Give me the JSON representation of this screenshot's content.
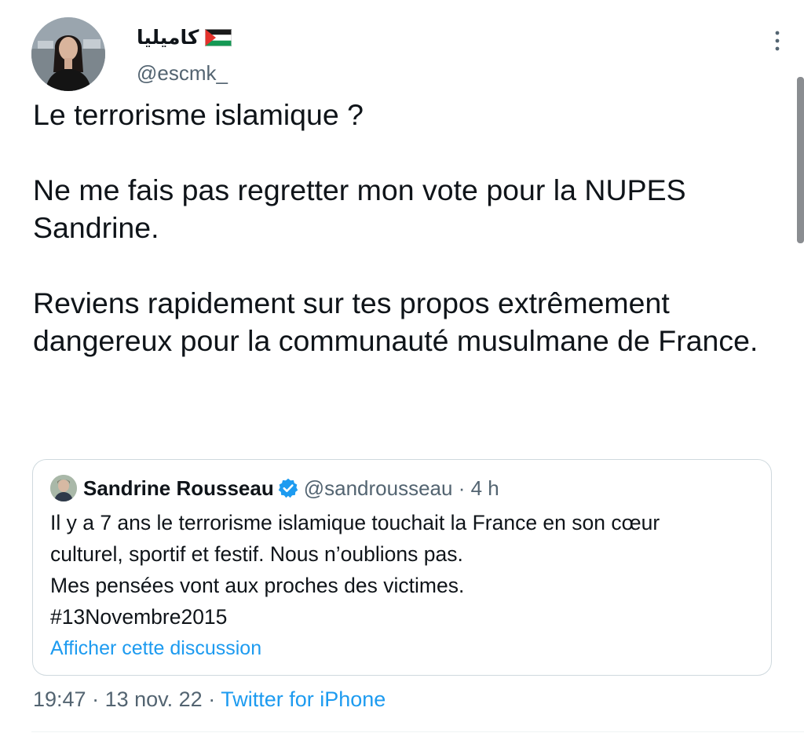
{
  "author": {
    "display_name": "كاميليا",
    "flag_icon": "palestine-flag-icon",
    "handle": "@escmk_"
  },
  "tweet": {
    "paragraphs": [
      "Le terrorisme islamique ?",
      "Ne me fais pas regretter mon vote pour la NUPES Sandrine.",
      "Reviens rapidement sur tes propos extrêmement dangereux pour la communauté musulmane de France."
    ]
  },
  "quote": {
    "name": "Sandrine Rousseau",
    "verified_icon": "verified-badge-icon",
    "handle": "@sandrousseau",
    "separator": "·",
    "time": "4 h",
    "lines": [
      "Il y a 7 ans le terrorisme islamique touchait la France en son cœur",
      "culturel, sportif et festif. Nous n’oublions pas.",
      "Mes pensées vont aux proches des victimes.",
      "#13Novembre2015"
    ],
    "show_thread": "Afficher cette discussion"
  },
  "meta": {
    "time": "19:47",
    "sep1": " · ",
    "date": "13 nov. 22",
    "sep2": " · ",
    "source": "Twitter for iPhone"
  },
  "colors": {
    "text": "#0f1419",
    "secondary": "#536471",
    "accent": "#1d9bf0",
    "border": "#cfd9de"
  },
  "icons": [
    "more-vertical-icon"
  ]
}
